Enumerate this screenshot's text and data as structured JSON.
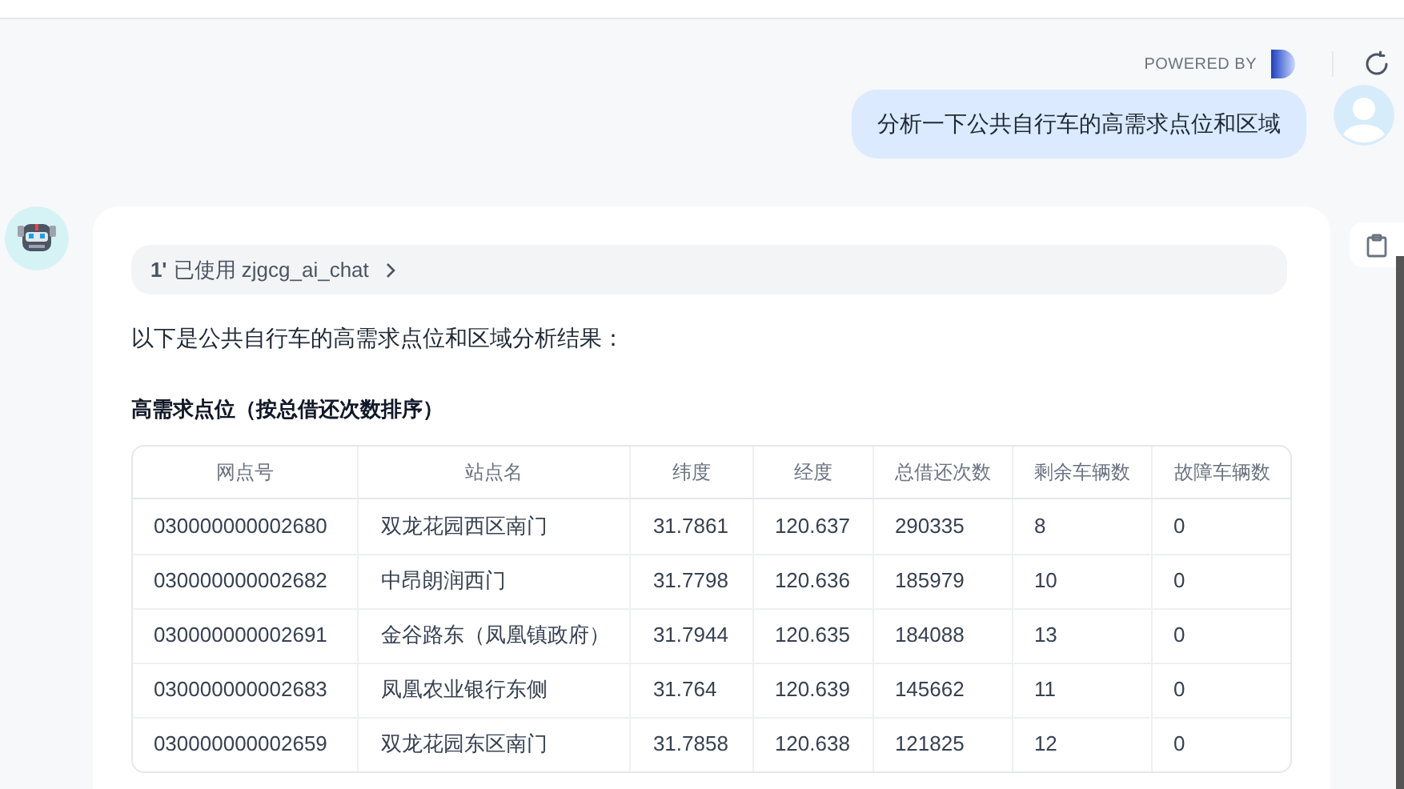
{
  "header": {
    "powered_by": "POWERED BY"
  },
  "user_message": {
    "text": "分析一下公共自行车的高需求点位和区域"
  },
  "reply": {
    "tool_chip": {
      "icon": "1'",
      "text": "已使用 zjgcg_ai_chat"
    },
    "intro": "以下是公共自行车的高需求点位和区域分析结果：",
    "section_title": "高需求点位（按总借还次数排序）",
    "table": {
      "columns": [
        "网点号",
        "站点名",
        "纬度",
        "经度",
        "总借还次数",
        "剩余车辆数",
        "故障车辆数"
      ],
      "rows": [
        [
          "030000000002680",
          "双龙花园西区南门",
          "31.7861",
          "120.637",
          "290335",
          "8",
          "0"
        ],
        [
          "030000000002682",
          "中昂朗润西门",
          "31.7798",
          "120.636",
          "185979",
          "10",
          "0"
        ],
        [
          "030000000002691",
          "金谷路东（凤凰镇政府）",
          "31.7944",
          "120.635",
          "184088",
          "13",
          "0"
        ],
        [
          "030000000002683",
          "凤凰农业银行东侧",
          "31.764",
          "120.639",
          "145662",
          "11",
          "0"
        ],
        [
          "030000000002659",
          "双龙花园东区南门",
          "31.7858",
          "120.638",
          "121825",
          "12",
          "0"
        ]
      ]
    }
  }
}
